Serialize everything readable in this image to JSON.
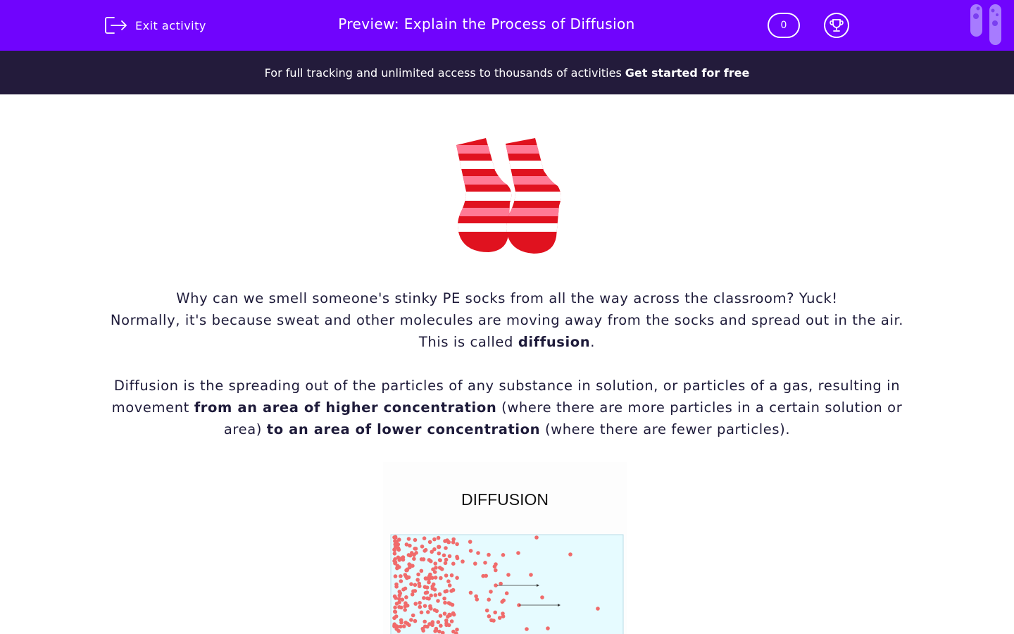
{
  "header": {
    "exit_label": "Exit activity",
    "title": "Preview: Explain the Process of Diffusion",
    "score": "0"
  },
  "banner": {
    "text": "For full tracking and unlimited access to thousands of activities",
    "cta": "Get started for free"
  },
  "content": {
    "p1_a": "Why can we smell someone's stinky PE socks from all the way across the classroom? Yuck!",
    "p1_b": "Normally, it's because sweat and other molecules are moving away from the socks and spread out in the air. This is called",
    "p1_bold": "diffusion",
    "p1_end": ".",
    "p2_a": "Diffusion is the spreading out of the particles of any substance in solution, or particles of a gas, resulting in movement",
    "p2_bold1": "from an area of higher concentration",
    "p2_b": "(where there are more particles in a certain solution or area)",
    "p2_bold2": "to an area of lower concentration",
    "p2_c": "(where there are fewer particles)."
  },
  "diagram": {
    "title": "DIFFUSION"
  },
  "colors": {
    "brand": "#7004fd",
    "banner": "#231b3b",
    "text": "#1e1b3a",
    "sock_red": "#e0121f",
    "sock_pink": "#ff6f8f",
    "particle": "#f06b6b",
    "diagram_bg": "#e6fbff"
  },
  "icons": [
    "exit-icon",
    "trophy-icon",
    "test-tubes-logo"
  ]
}
